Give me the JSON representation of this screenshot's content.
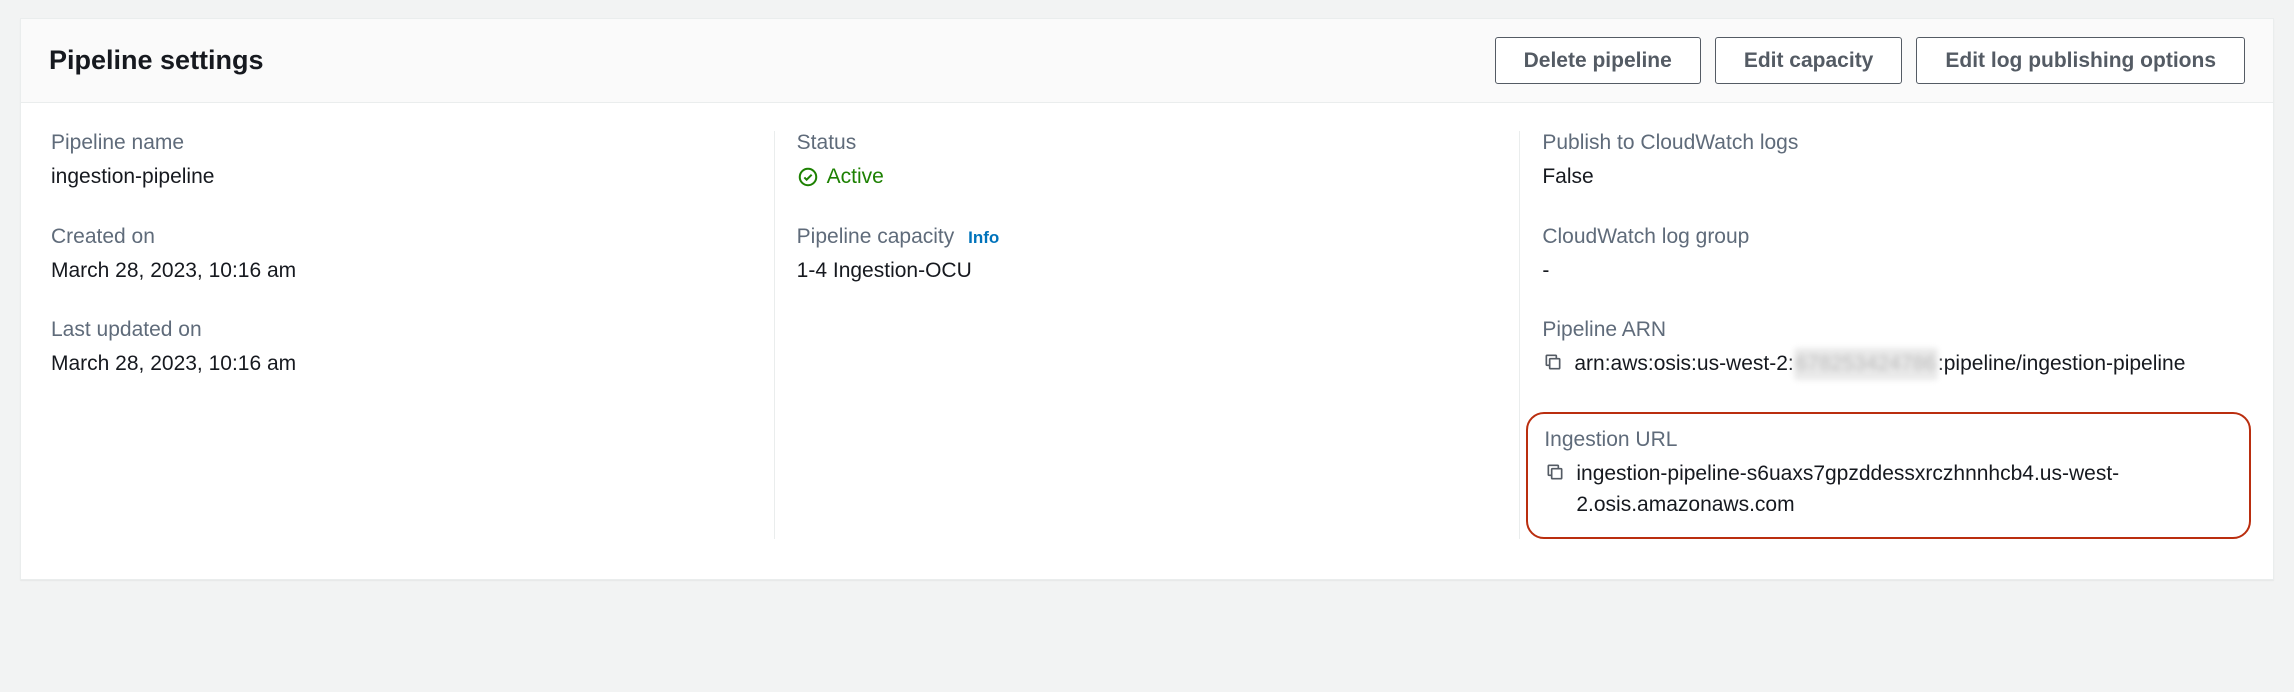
{
  "header": {
    "title": "Pipeline settings",
    "buttons": {
      "delete": "Delete pipeline",
      "edit_capacity": "Edit capacity",
      "edit_log": "Edit log publishing options"
    }
  },
  "col1": {
    "pipeline_name_label": "Pipeline name",
    "pipeline_name_value": "ingestion-pipeline",
    "created_on_label": "Created on",
    "created_on_value": "March 28, 2023, 10:16 am",
    "last_updated_label": "Last updated on",
    "last_updated_value": "March 28, 2023, 10:16 am"
  },
  "col2": {
    "status_label": "Status",
    "status_value": "Active",
    "capacity_label": "Pipeline capacity",
    "capacity_info": "Info",
    "capacity_value": "1-4 Ingestion-OCU"
  },
  "col3": {
    "publish_label": "Publish to CloudWatch logs",
    "publish_value": "False",
    "log_group_label": "CloudWatch log group",
    "log_group_value": "-",
    "arn_label": "Pipeline ARN",
    "arn_prefix": "arn:aws:osis:us-west-2:",
    "arn_redacted": "678253424786",
    "arn_suffix": ":pipeline/ingestion-pipeline",
    "ingestion_url_label": "Ingestion URL",
    "ingestion_url_value": "ingestion-pipeline-s6uaxs7gpzddessxrczhnnhcb4.us-west-2.osis.amazonaws.com"
  }
}
